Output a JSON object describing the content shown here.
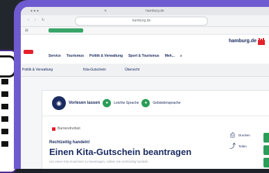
{
  "browser": {
    "tab_title": "",
    "url": "hamburg.de",
    "bookmark_pill_color": "#39a569"
  },
  "site": {
    "brand": "hamburg.de",
    "nav": [
      "Service",
      "Tourismus",
      "Politik & Verwaltung",
      "Sport & Tourismus",
      "Meh..."
    ],
    "subnav_left": "Politik & Verwaltung",
    "subnav_center": "Kita-Gutschein",
    "subnav_right": "Übersicht"
  },
  "voice": {
    "label": "Vorlesen lassen",
    "option1": "Leichte Sprache",
    "option2": "Gebärdensprache"
  },
  "article": {
    "flag": "Barrierefreiheit",
    "subtitle": "Rechtzeitig handeln!",
    "title": "Einen Kita-Gutschein beantragen",
    "desc": "Um einen Kita-Gutschein zu beantragen, sollten Sie rechtzeitig handeln."
  },
  "actions": [
    {
      "icon": "print-icon",
      "label": "Drucken"
    },
    {
      "icon": "share-icon",
      "label": "Teilen"
    }
  ],
  "colors": {
    "bezel": "#6f5bd0",
    "navy": "#1b2c61",
    "green": "#2a9d58",
    "red": "#e4212b"
  }
}
